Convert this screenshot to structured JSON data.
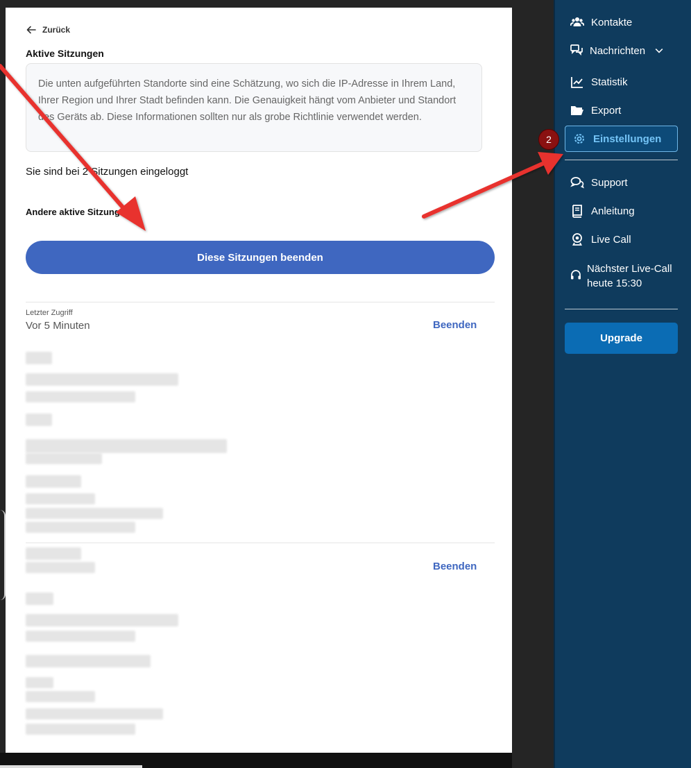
{
  "main": {
    "back_label": "Zurück",
    "section_title": "Aktive Sitzungen",
    "info_text": "Die unten aufgeführten Standorte sind eine Schätzung, wo sich die IP-Adresse in Ihrem Land, Ihrer Region und Ihrer Stadt befinden kann. Die Genauigkeit hängt vom Anbieter und Standort des Geräts ab. Diese Informationen sollten nur als grobe Richtlinie verwendet werden.",
    "session_count_text": "Sie sind bei 2 Sitzungen eingeloggt",
    "other_sessions_heading": "Andere aktive Sitzungen",
    "end_all_button": "Diese Sitzungen beenden",
    "sessions": [
      {
        "last_access_label": "Letzter Zugriff",
        "last_access_value": "Vor 5 Minuten",
        "end_label": "Beenden"
      },
      {
        "end_label": "Beenden"
      }
    ]
  },
  "sidebar": {
    "items": [
      {
        "label": "Kontakte",
        "icon": "users-icon"
      },
      {
        "label": "Nachrichten",
        "icon": "chat-icon"
      },
      {
        "label": "Statistik",
        "icon": "chart-icon"
      },
      {
        "label": "Export",
        "icon": "folder-open-icon"
      },
      {
        "label": "Einstellungen",
        "icon": "gear-icon",
        "active": true
      },
      {
        "label": "Support",
        "icon": "support-chat-icon"
      },
      {
        "label": "Anleitung",
        "icon": "book-icon"
      },
      {
        "label": "Live Call",
        "icon": "webcam-icon"
      }
    ],
    "next_live_call_line1": "Nächster Live-Call",
    "next_live_call_line2": "heute 15:30",
    "upgrade_label": "Upgrade",
    "active_color": "#74c4f7",
    "background_color": "#0f3b5d"
  },
  "annotation": {
    "step_number": "2",
    "arrow_color": "#e8312e"
  }
}
